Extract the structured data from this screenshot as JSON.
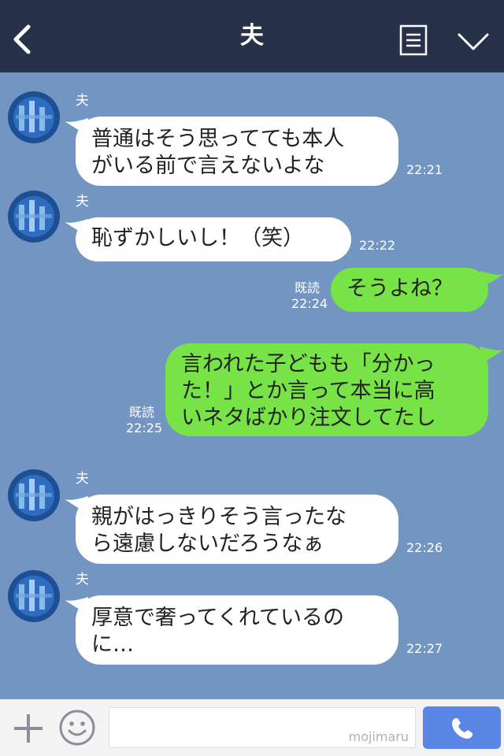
{
  "header": {
    "title": "夫"
  },
  "messages": [
    {
      "side": "in",
      "sender": "夫",
      "lines": [
        "普通はそう思ってても本人",
        "がいる前で言えないよな"
      ],
      "time": "22:21"
    },
    {
      "side": "in",
      "sender": "夫",
      "lines": [
        "恥ずかしいし！（笑）"
      ],
      "time": "22:22"
    },
    {
      "side": "out",
      "read": "既読",
      "lines": [
        "そうよね？"
      ],
      "time": "22:24"
    },
    {
      "side": "out",
      "read": "既読",
      "lines": [
        "言われた子どもも「分かっ",
        "た！」とか言って本当に高",
        "いネタばかり注文してたし"
      ],
      "time": "22:25"
    },
    {
      "side": "in",
      "sender": "夫",
      "lines": [
        "親がはっきりそう言ったな",
        "ら遠慮しないだろうなぁ"
      ],
      "time": "22:26"
    },
    {
      "side": "in",
      "sender": "夫",
      "lines": [
        "厚意で奢ってくれているの",
        "に…"
      ],
      "time": "22:27"
    }
  ],
  "input": {
    "watermark": "mojimaru"
  },
  "colors": {
    "header": "#27314a",
    "background": "#7395c2",
    "outgoing": "#78e346",
    "incoming": "#ffffff",
    "call": "#5b86e5"
  },
  "icons": [
    "back-icon",
    "menu-icon",
    "chevron-down-icon",
    "plus-icon",
    "smile-icon",
    "phone-icon"
  ]
}
